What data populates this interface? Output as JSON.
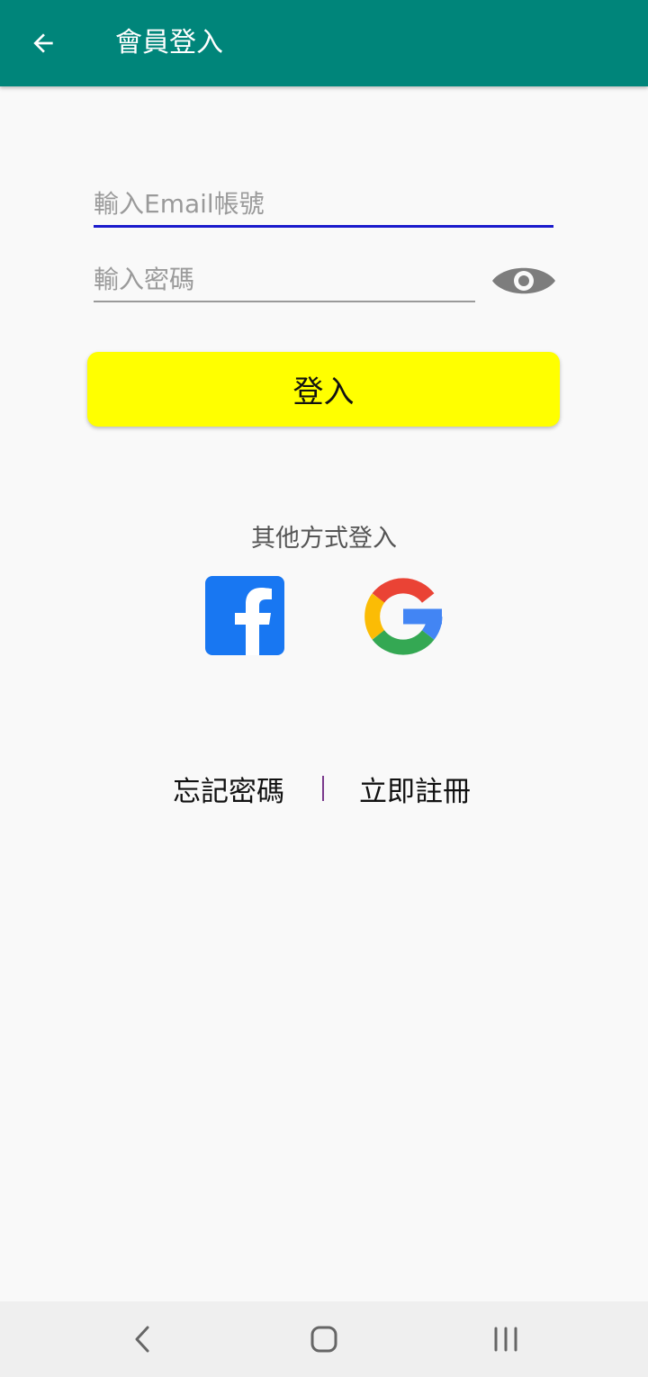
{
  "appbar": {
    "title": "會員登入",
    "back_icon": "arrow-left-icon",
    "background": "#00857a"
  },
  "form": {
    "email_placeholder": "輸入Email帳號",
    "email_value": "",
    "password_placeholder": "輸入密碼",
    "password_value": "",
    "toggle_icon": "eye-icon",
    "login_label": "登入",
    "login_color": "#ffff00"
  },
  "social": {
    "label": "其他方式登入",
    "providers": [
      {
        "name": "facebook-icon",
        "color": "#1877f2"
      },
      {
        "name": "google-icon",
        "color": "#4285f4"
      }
    ]
  },
  "links": {
    "forgot": "忘記密碼",
    "register": "立即註冊"
  },
  "navbar": {
    "icons": [
      "back-nav-icon",
      "home-nav-icon",
      "recents-nav-icon"
    ]
  }
}
